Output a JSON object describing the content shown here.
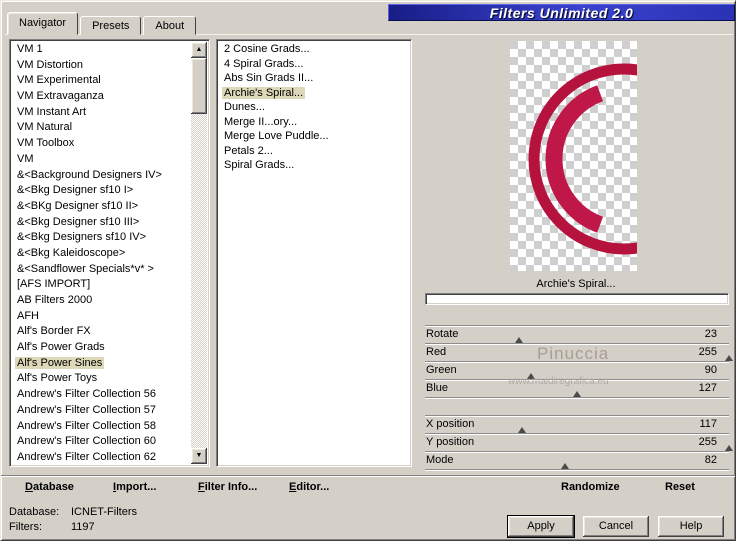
{
  "window": {
    "banner": "Filters Unlimited 2.0"
  },
  "tabs": {
    "navigator": "Navigator",
    "presets": "Presets",
    "about": "About"
  },
  "icons": {
    "up": "▲",
    "down": "▼"
  },
  "categories": [
    {
      "label": "VM 1"
    },
    {
      "label": "VM Distortion"
    },
    {
      "label": "VM Experimental"
    },
    {
      "label": "VM Extravaganza"
    },
    {
      "label": "VM Instant Art"
    },
    {
      "label": "VM Natural"
    },
    {
      "label": "VM Toolbox"
    },
    {
      "label": "VM"
    },
    {
      "label": "&<Background Designers IV>"
    },
    {
      "label": "&<Bkg Designer sf10 I>"
    },
    {
      "label": "&<BKg Designer sf10 II>"
    },
    {
      "label": "&<Bkg Designer sf10 III>"
    },
    {
      "label": "&<Bkg Designers sf10 IV>"
    },
    {
      "label": "&<Bkg Kaleidoscope>"
    },
    {
      "label": "&<Sandflower Specials*v* >"
    },
    {
      "label": "[AFS IMPORT]"
    },
    {
      "label": "AB Filters 2000"
    },
    {
      "label": "AFH"
    },
    {
      "label": "Alf's Border FX"
    },
    {
      "label": "Alf's Power Grads"
    },
    {
      "label": "Alf's Power Sines",
      "selected": true
    },
    {
      "label": "Alf's Power Toys"
    },
    {
      "label": "Andrew's Filter Collection 56"
    },
    {
      "label": "Andrew's Filter Collection 57"
    },
    {
      "label": "Andrew's Filter Collection 58"
    },
    {
      "label": "Andrew's Filter Collection 60"
    },
    {
      "label": "Andrew's Filter Collection 62"
    }
  ],
  "filters": [
    {
      "label": "2 Cosine Grads..."
    },
    {
      "label": "4 Spiral Grads..."
    },
    {
      "label": "Abs Sin Grads II..."
    },
    {
      "label": "Archie's Spiral...",
      "selected": true
    },
    {
      "label": "Dunes..."
    },
    {
      "label": "Merge II...ory..."
    },
    {
      "label": "Merge Love Puddle..."
    },
    {
      "label": "Petals 2..."
    },
    {
      "label": "Spiral Grads..."
    }
  ],
  "preview": {
    "filter_name": "Archie's Spiral...",
    "ring_color": "#b5123d",
    "arc_color": "#bf1848"
  },
  "sliders1": [
    {
      "label": "Rotate",
      "value": 23,
      "pct": 31
    },
    {
      "label": "Red",
      "value": 255,
      "pct": 100
    },
    {
      "label": "Green",
      "value": 90,
      "pct": 35
    },
    {
      "label": "Blue",
      "value": 127,
      "pct": 50
    }
  ],
  "sliders2": [
    {
      "label": "X position",
      "value": 117,
      "pct": 32
    },
    {
      "label": "Y position",
      "value": 255,
      "pct": 100
    },
    {
      "label": "Mode",
      "value": 82,
      "pct": 46
    }
  ],
  "watermark": {
    "line1": "Pinuccia",
    "line2": "www.maidiregrafica.eu"
  },
  "commands": {
    "database": "Database",
    "import": "Import...",
    "filter_info": "Filter Info...",
    "editor": "Editor...",
    "randomize": "Randomize",
    "reset": "Reset"
  },
  "status": {
    "database_label": "Database:",
    "database_value": "ICNET-Filters",
    "filters_label": "Filters:",
    "filters_value": "1197"
  },
  "actions": {
    "apply": "Apply",
    "cancel": "Cancel",
    "help": "Help"
  }
}
